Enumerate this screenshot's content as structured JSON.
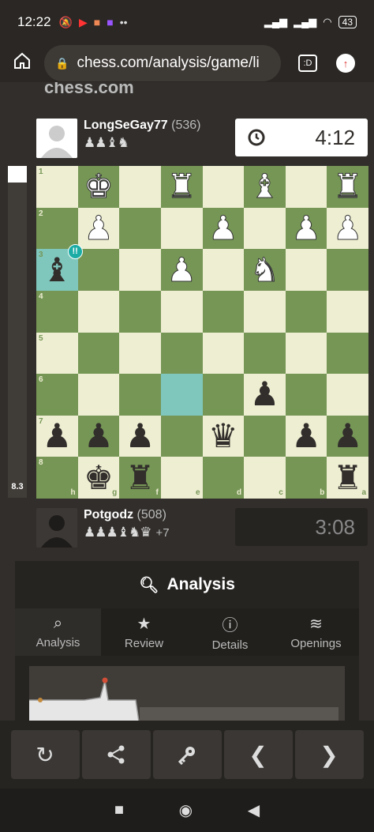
{
  "status": {
    "time": "12:22",
    "battery": "43"
  },
  "browser": {
    "url": "chess.com/analysis/game/li",
    "tab_count": ":D"
  },
  "site": {
    "logo": "chess.com"
  },
  "top_player": {
    "name": "LongSeGay77",
    "rating": "(536)",
    "captured": "♟♟♝♞",
    "clock": "4:12"
  },
  "bottom_player": {
    "name": "Potgodz",
    "rating": "(508)",
    "captured": "♟♟♟♝♞♛",
    "advantage": "+7",
    "clock": "3:08"
  },
  "eval": {
    "value": "8.3",
    "white_fraction": 0.05
  },
  "board": {
    "ranks": [
      "1",
      "2",
      "3",
      "4",
      "5",
      "6",
      "7",
      "8"
    ],
    "files": [
      "h",
      "g",
      "f",
      "e",
      "d",
      "c",
      "b",
      "a"
    ],
    "pieces": [
      [
        "",
        "wK",
        "",
        "wR",
        "",
        "wB",
        "",
        "wR"
      ],
      [
        "",
        "wP",
        "",
        "",
        "wP",
        "",
        "wP",
        "wP"
      ],
      [
        "bB",
        "",
        "",
        "wP",
        "",
        "wN",
        "",
        ""
      ],
      [
        "",
        "",
        "",
        "",
        "",
        "",
        "",
        ""
      ],
      [
        "",
        "",
        "",
        "",
        "",
        "",
        "",
        ""
      ],
      [
        "",
        "",
        "",
        "",
        "",
        "bP",
        "",
        ""
      ],
      [
        "bP",
        "bP",
        "bP",
        "",
        "bQ",
        "",
        "bP",
        "bP"
      ],
      [
        "",
        "bK",
        "bR",
        "",
        "",
        "",
        "",
        "bR"
      ]
    ],
    "highlights": [
      [
        2,
        0
      ],
      [
        5,
        3
      ]
    ],
    "brilliant_badge": "!!"
  },
  "analysis": {
    "title": "Analysis",
    "tabs": [
      {
        "label": "Analysis",
        "icon": "magnifier-icon"
      },
      {
        "label": "Review",
        "icon": "star-icon"
      },
      {
        "label": "Details",
        "icon": "info-icon"
      },
      {
        "label": "Openings",
        "icon": "book-icon"
      }
    ]
  },
  "controls": [
    "reset-icon",
    "share-icon",
    "key-icon",
    "chevron-left-icon",
    "chevron-right-icon"
  ]
}
